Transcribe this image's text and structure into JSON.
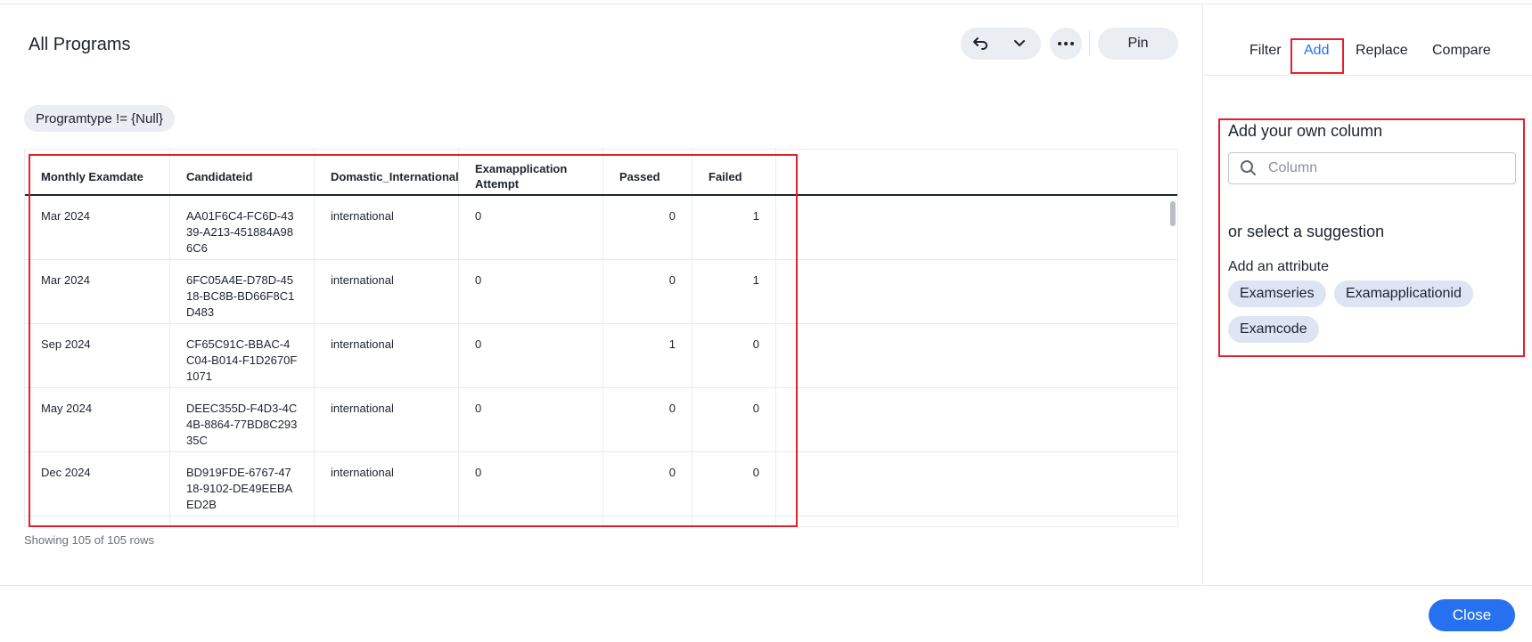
{
  "header": {
    "title": "All Programs",
    "pin_label": "Pin"
  },
  "icons": {
    "undo": "undo-arrow-icon",
    "dropdown": "chevron-down-icon",
    "more": "more-horizontal-icon",
    "search": "search-icon"
  },
  "filter_chip": "Programtype != {Null}",
  "table": {
    "columns": [
      "Monthly Examdate",
      "Candidateid",
      "Domastic_International",
      "Examapplication Attempt",
      "Passed",
      "Failed"
    ],
    "rows": [
      {
        "date": "Mar 2024",
        "id": "AA01F6C4-FC6D-4339-A213-451884A986C6",
        "type": "international",
        "attempt": "0",
        "passed": "0",
        "failed": "1"
      },
      {
        "date": "Mar 2024",
        "id": "6FC05A4E-D78D-4518-BC8B-BD66F8C1D483",
        "type": "international",
        "attempt": "0",
        "passed": "0",
        "failed": "1"
      },
      {
        "date": "Sep 2024",
        "id": "CF65C91C-BBAC-4C04-B014-F1D2670F1071",
        "type": "international",
        "attempt": "0",
        "passed": "1",
        "failed": "0"
      },
      {
        "date": "May 2024",
        "id": "DEEC355D-F4D3-4C4B-8864-77BD8C29335C",
        "type": "international",
        "attempt": "0",
        "passed": "0",
        "failed": "0"
      },
      {
        "date": "Dec 2024",
        "id": "BD919FDE-6767-4718-9102-DE49EEBAED2B",
        "type": "international",
        "attempt": "0",
        "passed": "0",
        "failed": "0"
      }
    ],
    "row_count": "Showing 105 of 105 rows"
  },
  "side_panel": {
    "tabs": [
      "Filter",
      "Add",
      "Replace",
      "Compare"
    ],
    "active_tab": "Add",
    "heading": "Add your own column",
    "search_placeholder": "Column",
    "suggestion_heading": "or select a suggestion",
    "attribute_label": "Add an attribute",
    "chips": [
      "Examseries",
      "Examapplicationid",
      "Examcode"
    ]
  },
  "footer": {
    "close_label": "Close"
  },
  "colors": {
    "accent": "#2770ef",
    "highlight": "#e5202e",
    "chip": "#eaedf2",
    "suggestion_chip": "#dde5f5"
  }
}
